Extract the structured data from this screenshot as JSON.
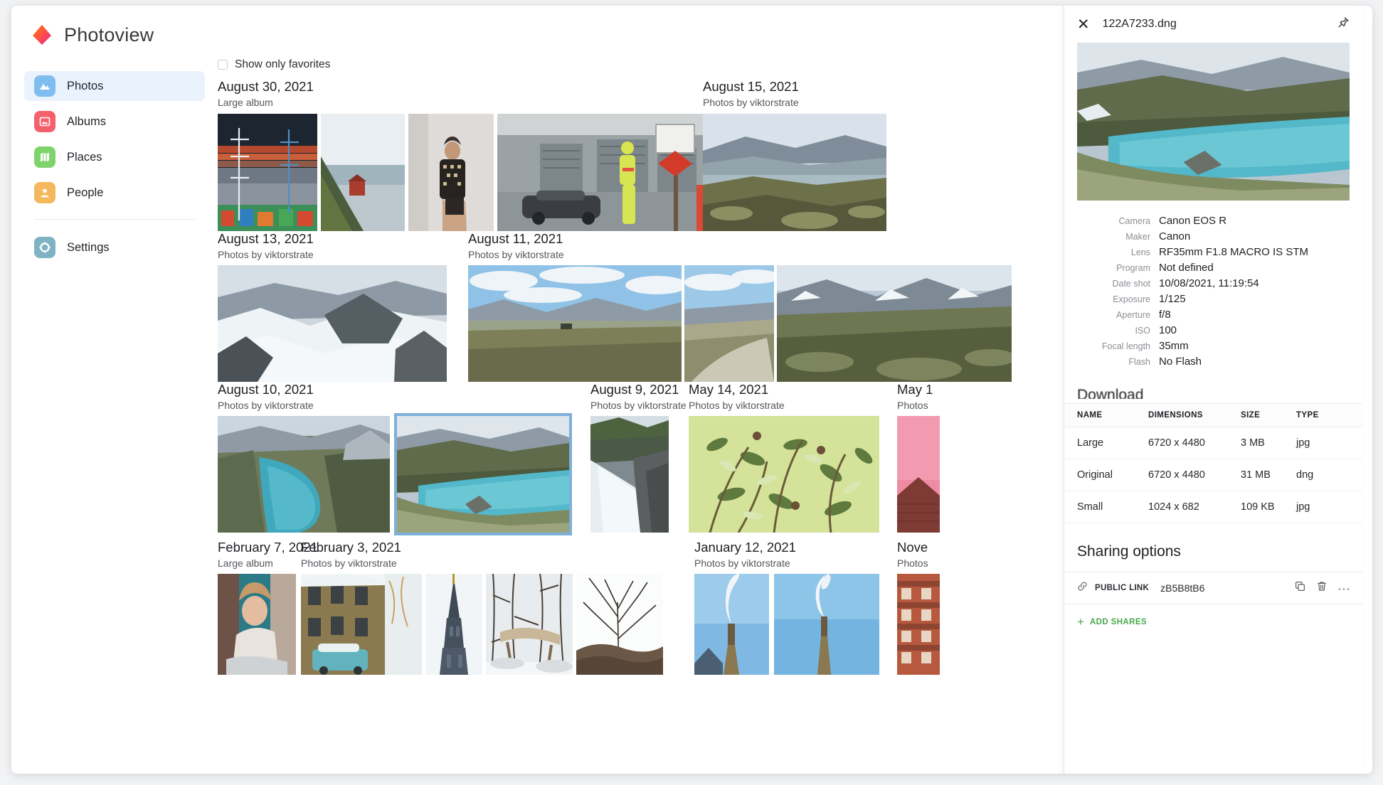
{
  "app": {
    "brand": "Photoview",
    "logo_icon": "photoview-logo-icon"
  },
  "sidebar": {
    "items": [
      {
        "label": "Photos",
        "icon": "photos-icon",
        "color": "#7fbdf0",
        "active": true
      },
      {
        "label": "Albums",
        "icon": "albums-icon",
        "color": "#f4606c",
        "active": false
      },
      {
        "label": "Places",
        "icon": "places-icon",
        "color": "#7ed36a",
        "active": false
      },
      {
        "label": "People",
        "icon": "people-icon",
        "color": "#f5b85c",
        "active": false
      }
    ],
    "settings": {
      "label": "Settings",
      "icon": "gear-icon",
      "color": "#7fb3c4"
    }
  },
  "main": {
    "favorites_filter": {
      "label": "Show only favorites",
      "checked": false
    },
    "groups": [
      {
        "date": "August 30, 2021",
        "subtitle": "Large album"
      },
      {
        "date": "August 15, 2021",
        "subtitle": "Photos by viktorstrate"
      },
      {
        "date": "August 13, 2021",
        "subtitle": "Photos by viktorstrate"
      },
      {
        "date": "August 11, 2021",
        "subtitle": "Photos by viktorstrate"
      },
      {
        "date": "August 10, 2021",
        "subtitle": "Photos by viktorstrate"
      },
      {
        "date": "August 9, 2021",
        "subtitle": "Photos by viktorstrate"
      },
      {
        "date": "May 14, 2021",
        "subtitle": "Photos by viktorstrate"
      },
      {
        "date": "May 1",
        "subtitle": "Photos"
      },
      {
        "date": "February 7, 2021",
        "subtitle": "Large album"
      },
      {
        "date": "February 3, 2021",
        "subtitle": "Photos by viktorstrate"
      },
      {
        "date": "January 12, 2021",
        "subtitle": "Photos by viktorstrate"
      },
      {
        "date": "Nove",
        "subtitle": "Photos"
      }
    ]
  },
  "panel": {
    "close_icon": "close-icon",
    "pin_icon": "pin-icon",
    "filename": "122A7233.dng",
    "hero_alt": "mountain-lake-photo",
    "exif": [
      {
        "key": "Camera",
        "value": "Canon EOS R"
      },
      {
        "key": "Maker",
        "value": "Canon"
      },
      {
        "key": "Lens",
        "value": "RF35mm F1.8 MACRO IS STM"
      },
      {
        "key": "Program",
        "value": "Not defined"
      },
      {
        "key": "Date shot",
        "value": "10/08/2021, 11:19:54"
      },
      {
        "key": "Exposure",
        "value": "1/125"
      },
      {
        "key": "Aperture",
        "value": "f/8"
      },
      {
        "key": "ISO",
        "value": "100"
      },
      {
        "key": "Focal length",
        "value": "35mm"
      },
      {
        "key": "Flash",
        "value": "No Flash"
      }
    ],
    "download": {
      "title": "Download",
      "columns": [
        "NAME",
        "DIMENSIONS",
        "SIZE",
        "TYPE"
      ],
      "rows": [
        {
          "name": "Large",
          "dimensions": "6720 x 4480",
          "size": "3 MB",
          "type": "jpg"
        },
        {
          "name": "Original",
          "dimensions": "6720 x 4480",
          "size": "31 MB",
          "type": "dng"
        },
        {
          "name": "Small",
          "dimensions": "1024 x 682",
          "size": "109 KB",
          "type": "jpg"
        }
      ]
    },
    "sharing": {
      "title": "Sharing options",
      "link_icon": "link-icon",
      "link_label": "PUBLIC LINK",
      "token": "zB5B8tB6",
      "copy_icon": "copy-icon",
      "delete_icon": "trash-icon",
      "more_icon": "more-dots-icon",
      "add_label": "ADD SHARES",
      "add_color": "#49a84c"
    }
  }
}
